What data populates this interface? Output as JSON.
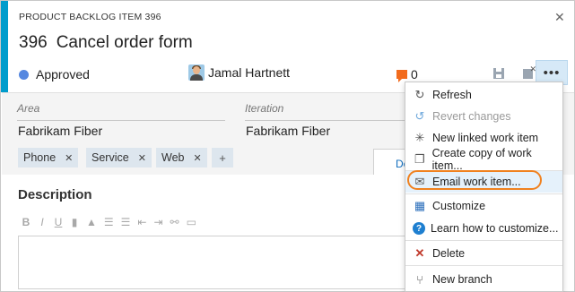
{
  "header": {
    "type_label": "PRODUCT BACKLOG ITEM 396",
    "close_icon": "close-icon",
    "id": "396",
    "title": "Cancel order form",
    "state": "Approved",
    "state_color": "#5688e0",
    "assignee": "Jamal Hartnett",
    "comment_count": "0",
    "accent_color": "#009ccc",
    "more_label": "•••"
  },
  "fields": {
    "area_label": "Area",
    "area_value": "Fabrikam Fiber",
    "iteration_label": "Iteration",
    "iteration_value": "Fabrikam Fiber"
  },
  "tags": [
    {
      "label": "Phone"
    },
    {
      "label": "Service"
    },
    {
      "label": "Web"
    }
  ],
  "tag_add_label": "+",
  "tag_remove_glyph": "✕",
  "tab_partial": "De",
  "description": {
    "title": "Description",
    "toolbar": [
      "B",
      "I",
      "U"
    ]
  },
  "menu": {
    "highlight_color": "#f0811f",
    "items": [
      {
        "label": "Refresh",
        "icon": "refresh-icon",
        "disabled": false
      },
      {
        "label": "Revert changes",
        "icon": "revert-icon",
        "disabled": true
      },
      {
        "label": "New linked work item",
        "icon": "new-linked-icon",
        "disabled": false
      },
      {
        "label": "Create copy of work item...",
        "icon": "copy-icon",
        "disabled": false
      },
      {
        "label": "Email work item...",
        "icon": "email-icon",
        "disabled": false
      },
      {
        "label": "Customize",
        "icon": "customize-icon",
        "disabled": false
      },
      {
        "label": "Learn how to customize...",
        "icon": "help-icon",
        "disabled": false
      },
      {
        "label": "Delete",
        "icon": "delete-icon",
        "disabled": false
      },
      {
        "label": "New branch",
        "icon": "branch-icon",
        "disabled": false
      }
    ]
  }
}
